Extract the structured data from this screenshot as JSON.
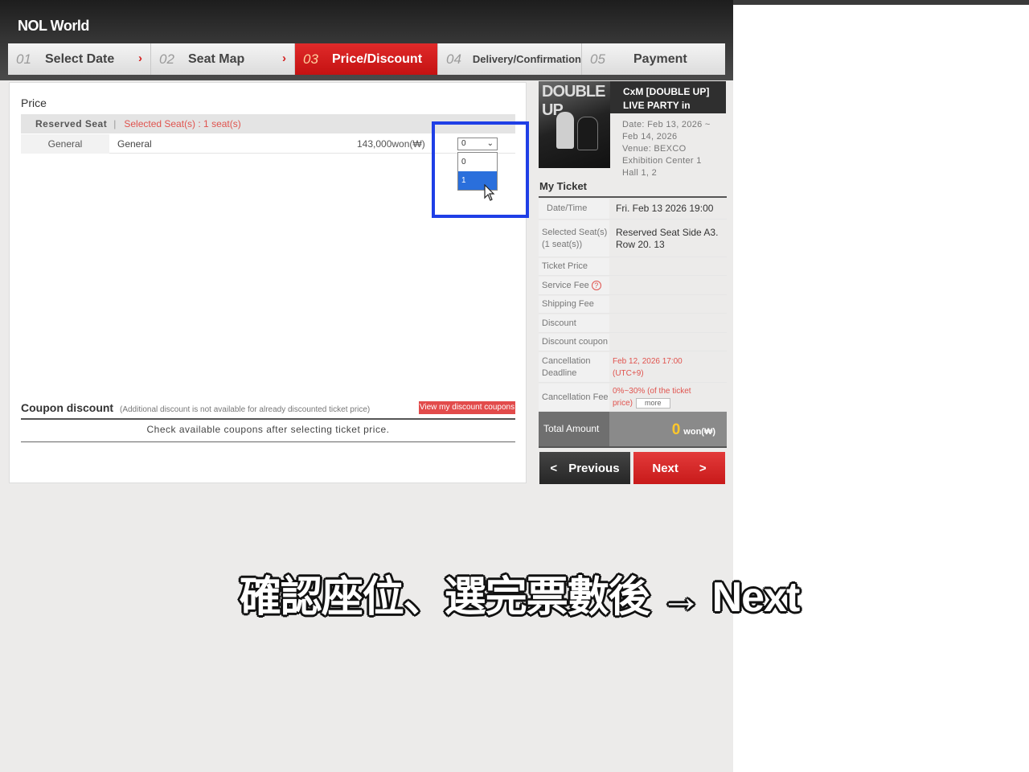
{
  "app": {
    "logo": "NOL World"
  },
  "steps": [
    {
      "num": "01",
      "label": "Select Date"
    },
    {
      "num": "02",
      "label": "Seat Map"
    },
    {
      "num": "03",
      "label": "Price/Discount"
    },
    {
      "num": "04",
      "label": "Delivery/Confirmation"
    },
    {
      "num": "05",
      "label": "Payment"
    }
  ],
  "price": {
    "title": "Price",
    "reserved_seat": "Reserved Seat",
    "selected_seats": "Selected Seat(s) : 1 seat(s)",
    "row": {
      "grade": "General",
      "type": "General",
      "amount": "143,000won(₩)"
    },
    "quantity_selected": "0",
    "options": [
      "0",
      "1"
    ]
  },
  "coupon": {
    "title": "Coupon discount",
    "note": "(Additional discount is not available for already discounted ticket price)",
    "button": "View my discount coupons",
    "message": "Check available coupons after selecting ticket price."
  },
  "event": {
    "poster_text": "DOUBLE UP",
    "title_line1": "CxM [DOUBLE UP]",
    "title_line2": "LIVE PARTY in",
    "date_line1": "Date: Feb 13, 2026 ~",
    "date_line2": "Feb 14, 2026",
    "venue_line1": "Venue: BEXCO",
    "venue_line2": "Exhibition Center 1",
    "venue_line3": "Hall 1, 2"
  },
  "ticket": {
    "title": "My Ticket",
    "datetime_label": "Date/Time",
    "datetime_value": "Fri. Feb 13 2026 19:00",
    "seats_label_1": "Selected Seat(s)",
    "seats_label_2": "(1 seat(s))",
    "seats_value_1": "Reserved Seat Side A3.",
    "seats_value_2": "Row 20. 13",
    "ticket_price_label": "Ticket Price",
    "service_fee_label": "Service Fee",
    "shipping_fee_label": "Shipping Fee",
    "discount_label": "Discount",
    "discount_coupon_label": "Discount coupon",
    "cancel_deadline_label_1": "Cancellation",
    "cancel_deadline_label_2": "Deadline",
    "cancel_deadline_value_1": "Feb 12, 2026 17:00",
    "cancel_deadline_value_2": "(UTC+9)",
    "cancel_fee_label": "Cancellation Fee",
    "cancel_fee_value_1": "0%~30% (of the ticket",
    "cancel_fee_value_2": "price)",
    "more": "more",
    "total_label": "Total Amount",
    "total_value": "0",
    "total_unit": "won(₩)"
  },
  "buttons": {
    "previous": "Previous",
    "next": "Next"
  },
  "subtitle": "確認座位、選完票數後 → Next",
  "colors": {
    "accent_red": "#d42020",
    "highlight_blue": "#1f3fe6",
    "total_yellow": "#ffc72a"
  }
}
